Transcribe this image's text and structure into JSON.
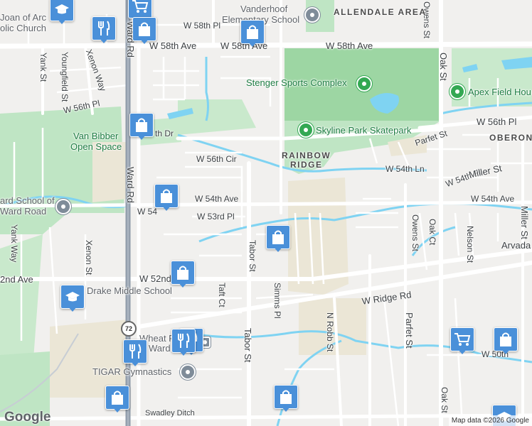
{
  "map": {
    "streets": {
      "w58th_pl": "W 58th Pl",
      "w58th_ave_a": "W 58th Ave",
      "w58th_ave_b": "W 58th Ave",
      "w58th_ave_c": "W 58th Ave",
      "w56th_pl_left": "W 56th Pl",
      "w56th_pl_right": "W 56th Pl",
      "th_dr": "th Dr",
      "w56th_cir": "W 56th Cir",
      "w54th_ln": "W 54th Ln",
      "w54th_ave_a": "W 54th Ave",
      "w54_trunc": "W 54",
      "w54th_ave_right": "W 54th Ave",
      "w54th_pl": "W 54th Pl",
      "w53rd_pl": "W 53rd Pl",
      "w52nd": "W 52nd",
      "nd_ave": "2nd Ave",
      "w_ridge_rd": "W Ridge Rd",
      "w50th": "W 50th",
      "ward_rd_top": "Ward Rd",
      "ward_rd_mid": "Ward Rd",
      "youngfield": "Youngfield St",
      "yank_st": "Yank St",
      "xenon_way": "Xenon Way",
      "yank_way": "Yank Way",
      "xenon_st": "Xenon St",
      "tabor_st": "Tabor St",
      "tabor_st_2": "Tabor St",
      "taft_ct": "Taft Ct",
      "simms_pl": "Simms Pl",
      "n_robb_st": "N Robb St",
      "owens_st_top": "Owens St",
      "owens_st": "Owens St",
      "oak_st_top": "Oak St",
      "oak_ct": "Oak Ct",
      "oak_st_bottom": "Oak St",
      "nelson_st": "Nelson St",
      "parfet_st_top": "Parfet St",
      "parfet_st": "Parfet St",
      "miller_st": "Miller St",
      "miller_st_v": "Miller St",
      "swadley_ditch": "Swadley Ditch"
    },
    "areas": {
      "allendale": "ALLENDALE AREA",
      "rainbow": "RAINBOW",
      "ridge": "RIDGE",
      "oberon": "OBERON",
      "arvada": "Arvada"
    },
    "places": {
      "joan_of_arc_1": "Joan of Arc",
      "joan_of_arc_2": "olic Church",
      "vanderhoof_1": "Vanderhoof",
      "vanderhoof_2": "Elementary School",
      "stenger": "Stenger Sports Complex",
      "apex": "Apex Field Hou",
      "skyline": "Skyline Park Skatepark",
      "van_bibber_1": "Van Bibber",
      "van_bibber_2": "Open Space",
      "ward_school_1": "ard School of",
      "ward_school_2": "Ward Road",
      "drake": "Drake Middle School",
      "wheat_1": "Wheat R",
      "wheat_2": "Ward",
      "tigar": "TIGAR Gymnastics"
    },
    "route_shield": "72",
    "logo": "Google",
    "attribution": "Map data ©2026 Google",
    "colors": {
      "background": "#f1f0ee",
      "park": "#bfe5c4",
      "park_dark": "#9dd6a3",
      "sand": "#ebe6d6",
      "water": "#7fd3f2",
      "road": "#ffffff",
      "highway": "#8e9aa8",
      "marker": "#4a90d9",
      "poi_green": "#34a853"
    },
    "markers": [
      {
        "name": "school-marker",
        "icon": "school-icon"
      },
      {
        "name": "shopping-cart-marker",
        "icon": "shopping-cart-icon"
      },
      {
        "name": "restaurant-marker",
        "icon": "fork-knife-icon"
      },
      {
        "name": "shopping-bag-marker",
        "icon": "shopping-bag-icon"
      }
    ]
  }
}
